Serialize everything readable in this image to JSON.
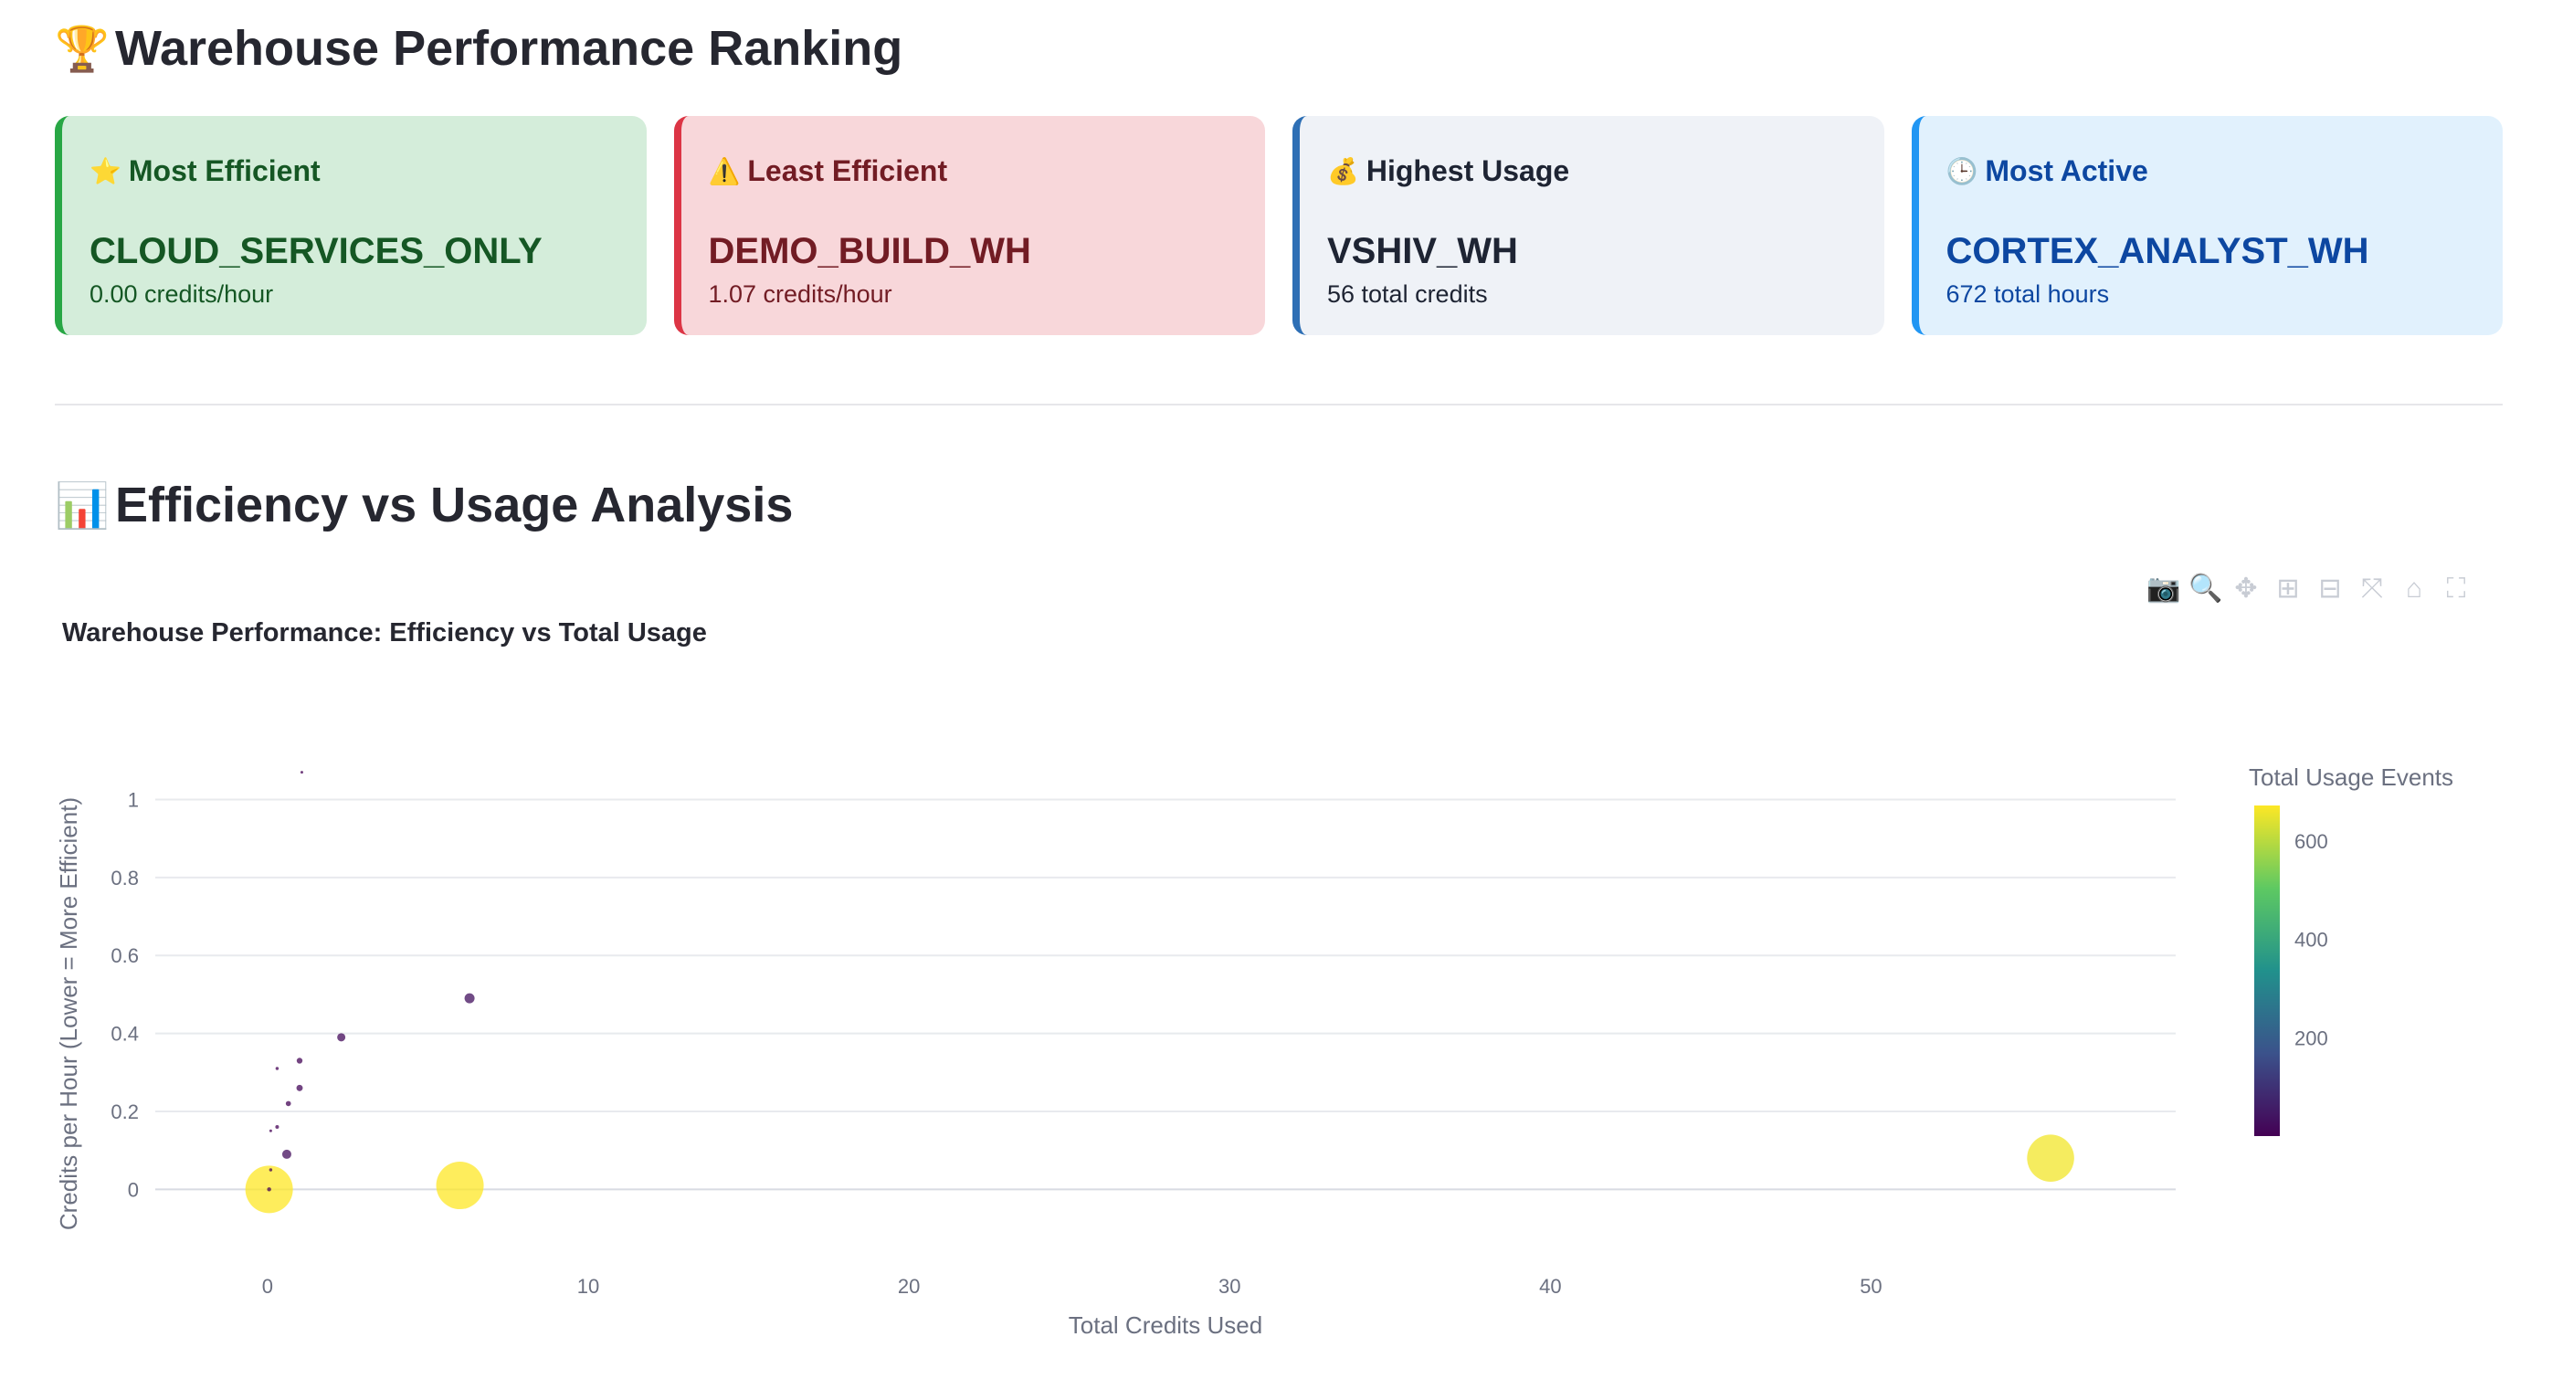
{
  "ranking": {
    "title": "Warehouse Performance Ranking",
    "icon": "trophy-icon",
    "icon_glyph": "🏆",
    "cards": [
      {
        "icon": "star-icon",
        "glyph": "⭐",
        "label": "Most Efficient",
        "value": "CLOUD_SERVICES_ONLY",
        "sub": "0.00 credits/hour"
      },
      {
        "icon": "warning-icon",
        "glyph": "⚠️",
        "label": "Least Efficient",
        "value": "DEMO_BUILD_WH",
        "sub": "1.07 credits/hour"
      },
      {
        "icon": "money-bag-icon",
        "glyph": "💰",
        "label": "Highest Usage",
        "value": "VSHIV_WH",
        "sub": "56 total credits"
      },
      {
        "icon": "clock-icon",
        "glyph": "🕒",
        "label": "Most Active",
        "value": "CORTEX_ANALYST_WH",
        "sub": "672 total hours"
      }
    ],
    "colors": {
      "green": "#28a745",
      "red": "#dc3545",
      "gray": "#2e6fb5",
      "blue": "#2196f3"
    }
  },
  "analysis": {
    "title": "Efficiency vs Usage Analysis",
    "icon": "bar-chart-icon",
    "icon_glyph": "📊"
  },
  "toolbar": {
    "buttons": [
      {
        "name": "camera-icon",
        "glyph": "📷"
      },
      {
        "name": "zoom-icon",
        "glyph": "🔍"
      },
      {
        "name": "pan-icon",
        "glyph": "✥"
      },
      {
        "name": "zoom-in-icon",
        "glyph": "⊞"
      },
      {
        "name": "zoom-out-icon",
        "glyph": "⊟"
      },
      {
        "name": "autoscale-icon",
        "glyph": "⤧"
      },
      {
        "name": "home-icon",
        "glyph": "⌂"
      },
      {
        "name": "fullscreen-icon",
        "glyph": "⛶"
      }
    ]
  },
  "chart_data": {
    "type": "scatter",
    "title": "Warehouse Performance: Efficiency vs Total Usage",
    "xlabel": "Total Credits Used",
    "ylabel": "Credits per Hour (Lower = More Efficient)",
    "xlim": [
      -3.5,
      59.5
    ],
    "ylim": [
      -0.1,
      1.13
    ],
    "xticks": [
      0,
      10,
      20,
      30,
      40,
      50
    ],
    "yticks": [
      0,
      0.2,
      0.4,
      0.6,
      0.8,
      1
    ],
    "grid": true,
    "colorbar": {
      "title": "Total Usage Events",
      "ticks": [
        200,
        400,
        600
      ],
      "min": 1,
      "max": 672,
      "colorscale": "Viridis"
    },
    "points": [
      {
        "x": 0.05,
        "y": 0.0,
        "events": 672
      },
      {
        "x": 6.0,
        "y": 0.01,
        "events": 672
      },
      {
        "x": 55.6,
        "y": 0.08,
        "events": 660
      },
      {
        "x": 6.3,
        "y": 0.49,
        "events": 30
      },
      {
        "x": 2.3,
        "y": 0.39,
        "events": 20
      },
      {
        "x": 1.0,
        "y": 0.33,
        "events": 10
      },
      {
        "x": 1.0,
        "y": 0.26,
        "events": 12
      },
      {
        "x": 0.65,
        "y": 0.22,
        "events": 8
      },
      {
        "x": 0.3,
        "y": 0.31,
        "events": 3
      },
      {
        "x": 0.3,
        "y": 0.16,
        "events": 4
      },
      {
        "x": 0.1,
        "y": 0.15,
        "events": 2
      },
      {
        "x": 0.6,
        "y": 0.09,
        "events": 25
      },
      {
        "x": 0.1,
        "y": 0.05,
        "events": 3
      },
      {
        "x": 0.05,
        "y": 0.0,
        "events": 5
      },
      {
        "x": 1.07,
        "y": 1.07,
        "events": 1
      }
    ]
  }
}
